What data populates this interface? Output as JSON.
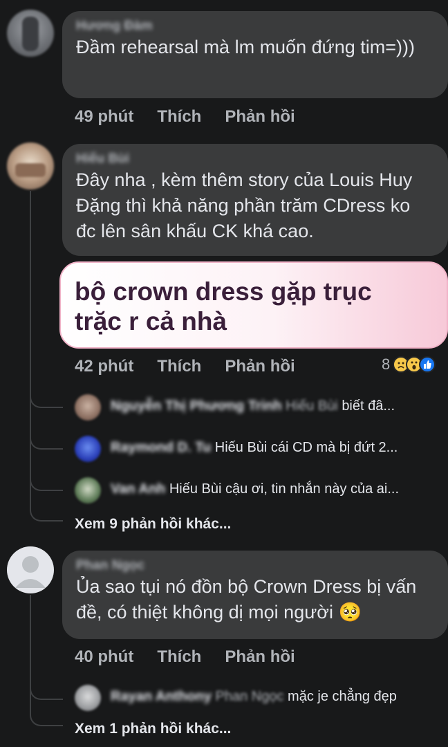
{
  "comments": [
    {
      "author": "Hương Đàm",
      "text": "Đầm rehearsal mà lm muốn đứng tim=)))",
      "time": "49 phút",
      "like_label": "Thích",
      "reply_label": "Phản hồi"
    },
    {
      "author": "Hiếu Bùi",
      "text": "Đây nha , kèm thêm story của Louis Huy Đặng thì khả năng phần trăm CDress ko đc lên sân khấu CK khá cao.",
      "sticker_text": "bộ crown dress gặp trục trặc r cả nhà",
      "time": "42 phút",
      "like_label": "Thích",
      "reply_label": "Phản hồi",
      "reaction_count": "8",
      "reaction_icons": [
        "sad-icon",
        "wow-icon",
        "like-icon"
      ],
      "replies": [
        {
          "author": "Nguyễn Thị Phương Trinh",
          "tag": "Hiếu Bùi",
          "text": "biết đâ..."
        },
        {
          "author": "Raymond D. Tu",
          "tag": "",
          "text": "Hiếu Bùi cái CD mà bị đứt 2..."
        },
        {
          "author": "Van Anh",
          "tag": "",
          "text": "Hiếu Bùi cậu ơi, tin nhắn này của ai..."
        }
      ],
      "more_replies": "Xem 9 phản hồi khác..."
    },
    {
      "author": "Phan Ngọc",
      "text": "Ủa sao tụi nó đồn bộ Crown Dress bị vấn đề, có thiệt không dị mọi người 🥺",
      "time": "40 phút",
      "like_label": "Thích",
      "reply_label": "Phản hồi",
      "replies": [
        {
          "author": "Rayan Anthony",
          "tag": "Phan Ngọc",
          "text": "mặc je chẳng đẹp"
        }
      ],
      "more_replies": "Xem 1 phản hồi khác..."
    }
  ],
  "colors": {
    "background": "#18191a",
    "bubble": "#3a3b3c",
    "text": "#e4e6eb",
    "muted": "#b0b3b8"
  }
}
